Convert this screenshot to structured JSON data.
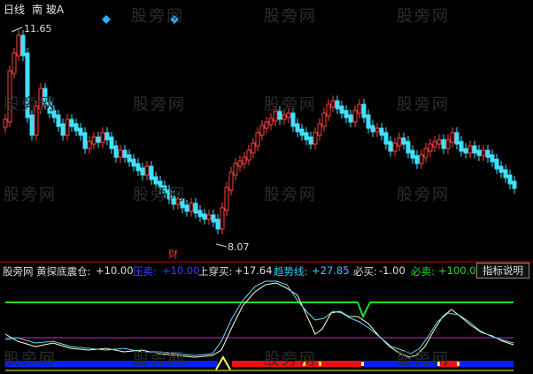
{
  "header": {
    "period_label": "日线",
    "stock_name": "南 玻A"
  },
  "price_labels": {
    "high": "11.65",
    "low": "8.07",
    "marker": "财"
  },
  "indicator": {
    "name": "股旁网 黄探底震仓:",
    "v1": "+10.00",
    "label2": "压卖:",
    "v2": "+10.00",
    "label3": "上穿买:",
    "v3": "+17.64",
    "label4": "趋势线:",
    "v4": "+27.85",
    "label5": "必买:",
    "v5": "-1.00",
    "label6": "必卖:",
    "v6": "+100.0",
    "explain_button": "指标说明"
  },
  "watermark": "股旁网",
  "colors": {
    "up": "#ff4040",
    "down": "#40e0ff",
    "green": "#22dd22",
    "magenta": "#cc22cc",
    "blue": "#0022ff",
    "red": "#ee1111",
    "yellow": "#ffff44"
  }
}
